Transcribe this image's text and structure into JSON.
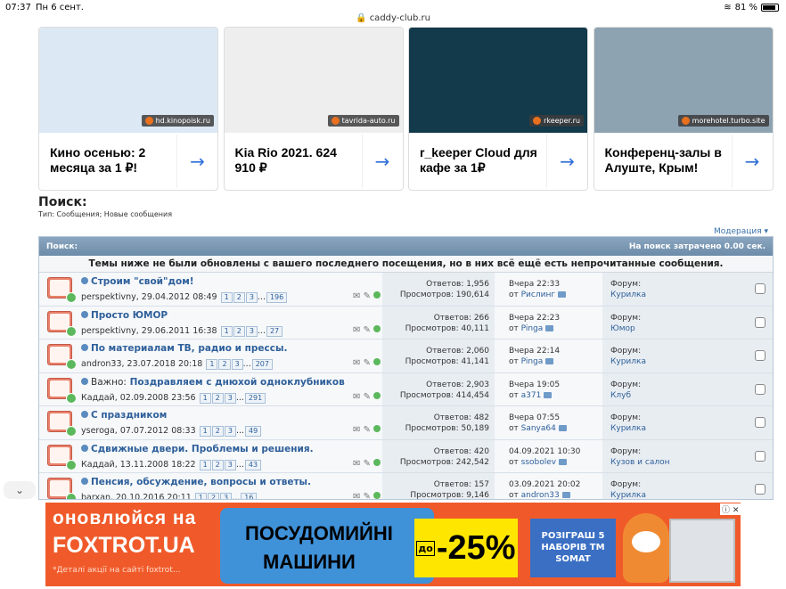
{
  "status": {
    "time": "07:37",
    "date": "Пн 6 сент.",
    "url": "caddy-club.ru",
    "battery": "81 %"
  },
  "cards": [
    {
      "source": "hd.kinopoisk.ru",
      "title": "Кино осенью: 2 месяца за 1 ₽!",
      "img_color": "#dce8f4"
    },
    {
      "source": "tavrida-auto.ru",
      "title": "Kia Rio 2021. 624 910 ₽",
      "img_color": "#eeeeee"
    },
    {
      "source": "rkeeper.ru",
      "title": "r_keeper Cloud для кафе за 1₽",
      "img_color": "#123a4a"
    },
    {
      "source": "morehotel.turbo.site",
      "title": "Конференц-залы в Алуште, Крым!",
      "img_color": "#8ea3b2"
    }
  ],
  "search": {
    "title": "Поиск:",
    "type_line": "Тип: Сообщения; Новые сообщения",
    "moderation": "Модерация ▾"
  },
  "grid": {
    "header_left": "Поиск:",
    "header_right": "На поиск затрачено 0.00 сек.",
    "notice": "Темы ниже не были обновлены с вашего последнего посещения, но в них всё ещё есть непрочитанные сообщения.",
    "rows": [
      {
        "title": "Строим \"свой\"дом!",
        "prefix": "",
        "author": "perspektivny",
        "date": "29.04.2012 08:49",
        "pages": [
          "1",
          "2",
          "3",
          "...",
          "196"
        ],
        "replies": "Ответов: 1,956",
        "views": "Просмотров: 190,614",
        "last_time": "Вчера 22:33",
        "last_by_label": "от",
        "last_by": "Рислинг",
        "forum_label": "Форум:",
        "forum": "Курилка"
      },
      {
        "title": "Просто ЮМОР",
        "prefix": "",
        "author": "perspektivny",
        "date": "29.06.2011 16:38",
        "pages": [
          "1",
          "2",
          "3",
          "...",
          "27"
        ],
        "replies": "Ответов: 266",
        "views": "Просмотров: 40,111",
        "last_time": "Вчера 22:23",
        "last_by_label": "от",
        "last_by": "Pinga",
        "forum_label": "Форум:",
        "forum": "Юмор"
      },
      {
        "title": "По материалам ТВ, радио и прессы.",
        "prefix": "",
        "author": "andron33",
        "date": "23.07.2018 20:18",
        "pages": [
          "1",
          "2",
          "3",
          "...",
          "207"
        ],
        "replies": "Ответов: 2,060",
        "views": "Просмотров: 41,141",
        "last_time": "Вчера 22:14",
        "last_by_label": "от",
        "last_by": "Pinga",
        "forum_label": "Форум:",
        "forum": "Курилка"
      },
      {
        "title": "Поздравляем с днюхой одноклубников",
        "prefix": "Важно:",
        "author": "Каддай",
        "date": "02.09.2008 23:56",
        "pages": [
          "1",
          "2",
          "3",
          "...",
          "291"
        ],
        "replies": "Ответов: 2,903",
        "views": "Просмотров: 414,454",
        "last_time": "Вчера 19:05",
        "last_by_label": "от",
        "last_by": "a371",
        "forum_label": "Форум:",
        "forum": "Клуб"
      },
      {
        "title": "С праздником",
        "prefix": "",
        "author": "yseroga",
        "date": "07.07.2012 08:33",
        "pages": [
          "1",
          "2",
          "3",
          "...",
          "49"
        ],
        "replies": "Ответов: 482",
        "views": "Просмотров: 50,189",
        "last_time": "Вчера 07:55",
        "last_by_label": "от",
        "last_by": "Sanya64",
        "forum_label": "Форум:",
        "forum": "Курилка"
      },
      {
        "title": "Сдвижные двери. Проблемы и решения.",
        "prefix": "",
        "author": "Каддай",
        "date": "13.11.2008 18:22",
        "pages": [
          "1",
          "2",
          "3",
          "...",
          "43"
        ],
        "replies": "Ответов: 420",
        "views": "Просмотров: 242,542",
        "last_time": "04.09.2021 10:30",
        "last_by_label": "от",
        "last_by": "ssobolev",
        "forum_label": "Форум:",
        "forum": "Кузов и салон"
      },
      {
        "title": "Пенсия, обсуждение, вопросы и ответы.",
        "prefix": "",
        "author": "barxan",
        "date": "20.10.2016 20:11",
        "pages": [
          "1",
          "2",
          "3",
          "...",
          "16"
        ],
        "replies": "Ответов: 157",
        "views": "Просмотров: 9,146",
        "last_time": "03.09.2021 20:02",
        "last_by_label": "от",
        "last_by": "andron33",
        "forum_label": "Форум:",
        "forum": "Курилка"
      }
    ]
  },
  "banner": {
    "line1": "оновлюйся на",
    "line2": "FOXTROT.UA",
    "line3": "*Деталі акції на сайті foxtrot...",
    "mid1": "ПОСУДОМИЙНІ",
    "mid2": "МАШИНИ",
    "disc_prefix": "до",
    "discount": "-25%",
    "promo": "РОЗІГРАШ 5 НАБОРІВ ТМ SOMAT",
    "close": "ⓘ ✕"
  },
  "scroll_button": "⌄"
}
